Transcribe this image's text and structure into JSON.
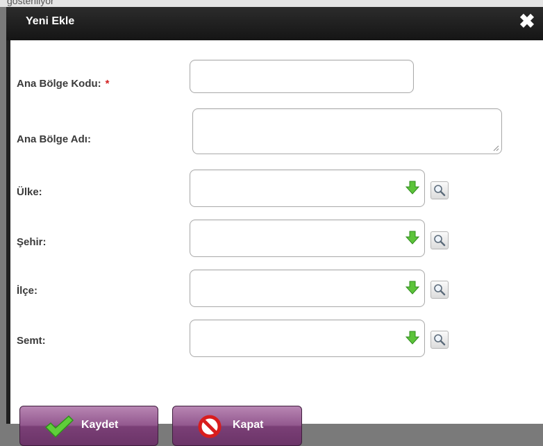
{
  "background": {
    "text": "gösteriliyor"
  },
  "dialog": {
    "title": "Yeni Ekle",
    "close_symbol": "✖"
  },
  "form": {
    "ana_bolge_kodu": {
      "label": "Ana Bölge Kodu:",
      "required_mark": "*",
      "value": ""
    },
    "ana_bolge_adi": {
      "label": "Ana Bölge Adı:",
      "value": ""
    },
    "ulke": {
      "label": "Ülke:",
      "value": ""
    },
    "sehir": {
      "label": "Şehir:",
      "value": ""
    },
    "ilce": {
      "label": "İlçe:",
      "value": ""
    },
    "semt": {
      "label": "Semt:",
      "value": ""
    }
  },
  "buttons": {
    "save": {
      "label": "Kaydet",
      "icon": "checkmark-icon"
    },
    "close": {
      "label": "Kapat",
      "icon": "no-entry-icon"
    }
  },
  "icons": {
    "dropdown": "green-down-arrow-icon",
    "lookup": "magnifier-icon"
  },
  "colors": {
    "titlebar": "#1f1f1f",
    "button": "#93598f",
    "required": "#d22020",
    "dropdown_arrow": "#5cc43a"
  }
}
